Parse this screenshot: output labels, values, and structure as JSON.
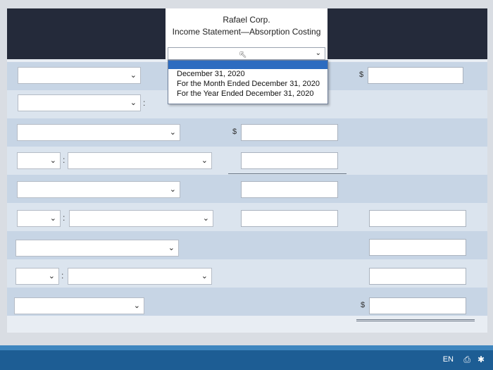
{
  "header": {
    "company": "Rafael Corp.",
    "statement_title": "Income Statement—Absorption Costing",
    "date_select_value": ""
  },
  "dropdown": {
    "options": [
      "December 31, 2020",
      "For the Month Ended December 31, 2020",
      "For the Year Ended December 31, 2020"
    ]
  },
  "glyphs": {
    "chevron": "⌵",
    "dollar": "$",
    "colon": ":",
    "cursor": "↖"
  },
  "taskbar": {
    "language": "EN"
  },
  "colors": {
    "header_bg": "#242a3a",
    "highlight": "#2d6cc0",
    "row_dark": "#c7d5e5",
    "row_light": "#dbe4ee"
  }
}
